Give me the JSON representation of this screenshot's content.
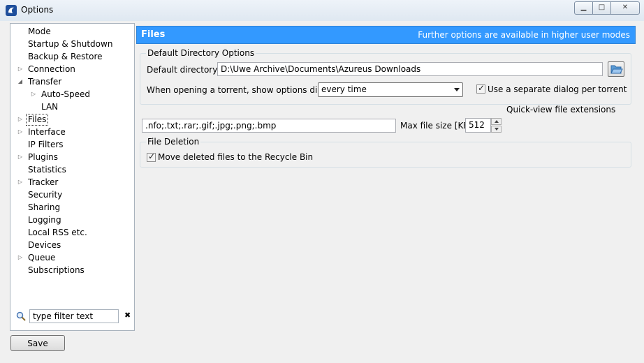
{
  "window": {
    "title": "Options",
    "app_icon": "azureus-frog-icon"
  },
  "window_controls": {
    "minimize": "▁",
    "maximize": "□",
    "close": "✕"
  },
  "sidebar": {
    "items": [
      {
        "label": "Mode",
        "expandable": false,
        "level": 0
      },
      {
        "label": "Startup & Shutdown",
        "expandable": false,
        "level": 0
      },
      {
        "label": "Backup & Restore",
        "expandable": false,
        "level": 0
      },
      {
        "label": "Connection",
        "expandable": true,
        "expanded": false,
        "level": 0
      },
      {
        "label": "Transfer",
        "expandable": true,
        "expanded": true,
        "level": 0
      },
      {
        "label": "Auto-Speed",
        "expandable": true,
        "expanded": false,
        "level": 1
      },
      {
        "label": "LAN",
        "expandable": false,
        "level": 1
      },
      {
        "label": "Files",
        "expandable": true,
        "expanded": false,
        "level": 0,
        "selected": true
      },
      {
        "label": "Interface",
        "expandable": true,
        "expanded": false,
        "level": 0
      },
      {
        "label": "IP Filters",
        "expandable": false,
        "level": 0
      },
      {
        "label": "Plugins",
        "expandable": true,
        "expanded": false,
        "level": 0
      },
      {
        "label": "Statistics",
        "expandable": false,
        "level": 0
      },
      {
        "label": "Tracker",
        "expandable": true,
        "expanded": false,
        "level": 0
      },
      {
        "label": "Security",
        "expandable": false,
        "level": 0
      },
      {
        "label": "Sharing",
        "expandable": false,
        "level": 0
      },
      {
        "label": "Logging",
        "expandable": false,
        "level": 0
      },
      {
        "label": "Local RSS etc.",
        "expandable": false,
        "level": 0
      },
      {
        "label": "Devices",
        "expandable": false,
        "level": 0
      },
      {
        "label": "Queue",
        "expandable": true,
        "expanded": false,
        "level": 0
      },
      {
        "label": "Subscriptions",
        "expandable": false,
        "level": 0
      }
    ],
    "filter": {
      "value": "type filter text",
      "search_icon": "magnifier-icon",
      "clear_icon": "clear-icon",
      "clear_glyph": "✖"
    }
  },
  "footer": {
    "save_label": "Save"
  },
  "main": {
    "header": {
      "title": "Files",
      "note": "Further options are available in higher user modes"
    },
    "default_dir_group": {
      "title": "Default Directory Options",
      "dir_label": "Default directory:",
      "dir_value": "D:\\Uwe Archive\\Documents\\Azureus Downloads",
      "browse_icon": "folder-open-icon",
      "show_dialog_label": "When opening a torrent, show options dialog:",
      "show_dialog_value": "every time",
      "separate_dialog_label": "Use a separate dialog per torrent",
      "separate_dialog_checked": true
    },
    "quickview": {
      "title": "Quick-view file extensions",
      "extensions": ".nfo;.txt;.rar;.gif;.jpg;.png;.bmp",
      "max_size_label": "Max file size [KB]",
      "max_size_value": "512"
    },
    "deletion_group": {
      "title": "File Deletion",
      "recycle_label": "Move deleted files to the Recycle Bin",
      "recycle_checked": true
    }
  },
  "colors": {
    "header_bg": "#3399ff",
    "header_text": "#ffffff",
    "window_bg": "#f0f0f0"
  }
}
